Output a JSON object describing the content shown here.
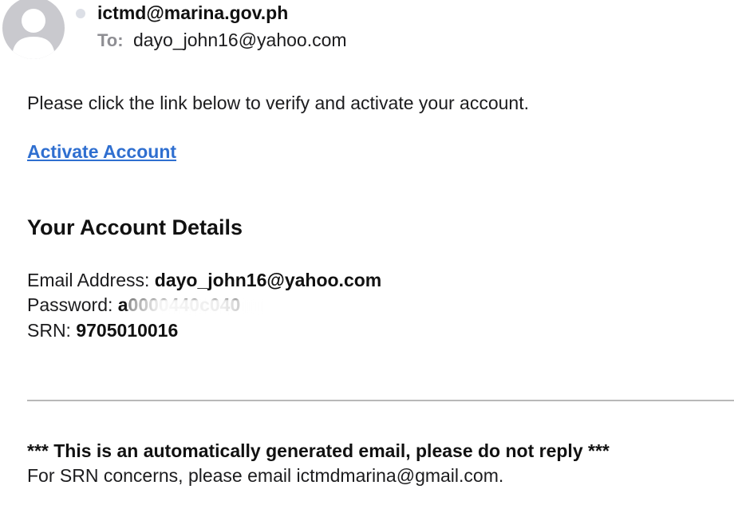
{
  "header": {
    "sender": "ictmd@marina.gov.ph",
    "to_label": "To:",
    "to_address": "dayo_john16@yahoo.com"
  },
  "message": {
    "intro": "Please click the link below to verify and activate your account.",
    "activate_link": "Activate Account",
    "details_heading": "Your Account Details",
    "email_label": "Email Address: ",
    "email_value": "dayo_john16@yahoo.com",
    "password_label": "Password: ",
    "password_value": "a0000440c040",
    "srn_label": "SRN: ",
    "srn_value": "9705010016",
    "auto_note": "*** This is an automatically generated email, please do not reply ***",
    "concerns": "For SRN concerns, please email ictmdmarina@gmail.com."
  },
  "colors": {
    "link": "#2f6fd0",
    "muted": "#8e8e93",
    "avatar_bg": "#c9c9ce",
    "divider": "#b8b8b8"
  },
  "icons": {
    "avatar": "person-silhouette-icon",
    "unread": "unread-dot-icon"
  }
}
